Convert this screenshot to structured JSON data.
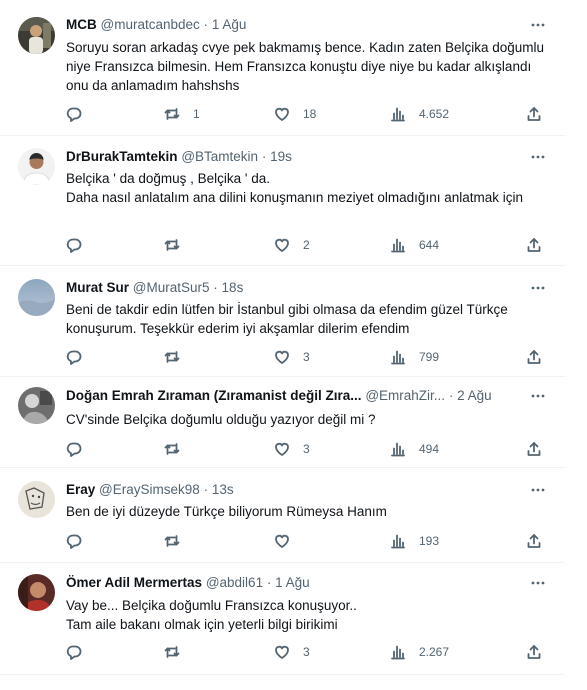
{
  "tweets": [
    {
      "name": "MCB",
      "handle": "@muratcanbdec",
      "dot": "·",
      "time": "1 Ağu",
      "text": "Soruyu soran arkadaş cvye pek bakmamış bence. Kadın zaten Belçika doğumlu niye Fransızca bilmesin. Hem Fransızca konuştu diye niye bu kadar alkışlandı onu da anlamadım hahshshs",
      "replies": "",
      "retweets": "1",
      "likes": "18",
      "views": "4.652"
    },
    {
      "name": "DrBurakTamtekin",
      "handle": "@BTamtekin",
      "dot": "·",
      "time": "19s",
      "text": "Belçika ' da doğmuş , Belçika ' da.\nDaha nasıl anlatalım ana dilini konuşmanın  meziyet olmadığını anlatmak için",
      "replies": "",
      "retweets": "",
      "likes": "2",
      "views": "644"
    },
    {
      "name": "Murat Sur",
      "handle": "@MuratSur5",
      "dot": "·",
      "time": "18s",
      "text": "Beni de takdir edin lütfen bir İstanbul gibi olmasa da efendim güzel Türkçe konuşurum. Teşekkür ederim iyi akşamlar dilerim efendim",
      "replies": "",
      "retweets": "",
      "likes": "3",
      "views": "799"
    },
    {
      "name": "Doğan Emrah Zıraman (Zıramanist değil Zıra...",
      "handle": "@EmrahZir...",
      "dot": "·",
      "time": "2 Ağu",
      "text": "CV'sinde Belçika doğumlu olduğu yazıyor değil mi ?",
      "replies": "",
      "retweets": "",
      "likes": "3",
      "views": "494"
    },
    {
      "name": "Eray",
      "handle": "@ErayS​imsek98",
      "dot": "·",
      "time": "13s",
      "text": "Ben de iyi düzeyde Türkçe biliyorum Rümeysa Hanım",
      "replies": "",
      "retweets": "",
      "likes": "",
      "views": "193"
    },
    {
      "name": "Ömer Adil Mermertas",
      "handle": "@abdil61",
      "dot": "·",
      "time": "1 Ağu",
      "text": "Vay be... Belçika doğumlu Fransızca konuşuyor..\nTam aile bakanı olmak için yeterli bilgi birikimi",
      "replies": "",
      "retweets": "",
      "likes": "3",
      "views": "2.267"
    }
  ],
  "colors": {
    "text": "#0f1419",
    "secondary": "#536471",
    "border": "#eff3f4"
  },
  "icons": [
    "more-icon",
    "reply-icon",
    "retweet-icon",
    "like-icon",
    "views-icon",
    "share-icon"
  ]
}
